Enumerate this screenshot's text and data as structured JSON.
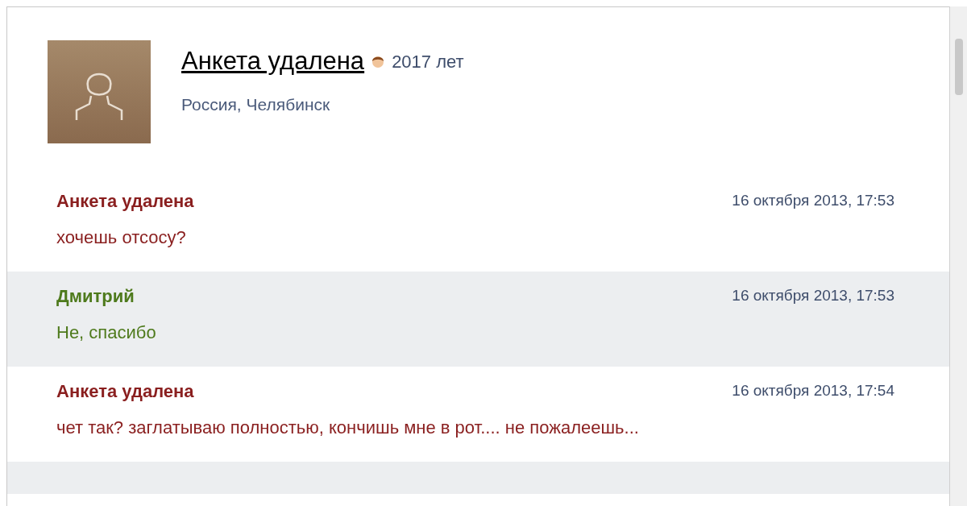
{
  "profile": {
    "name": "Анкета удалена",
    "age": "2017 лет",
    "location": "Россия, Челябинск"
  },
  "messages": [
    {
      "author": "Анкета удалена",
      "kind": "incoming",
      "date": "16 октября 2013, 17:53",
      "text": "хочешь отсосу?"
    },
    {
      "author": "Дмитрий",
      "kind": "outgoing",
      "date": "16 октября 2013, 17:53",
      "text": "Не, спасибо"
    },
    {
      "author": "Анкета удалена",
      "kind": "incoming",
      "date": "16 октября 2013, 17:54",
      "text": "чет так? заглатываю полностью, кончишь мне в рот.... не пожалеешь..."
    },
    {
      "kind": "outgoing_cut"
    }
  ]
}
